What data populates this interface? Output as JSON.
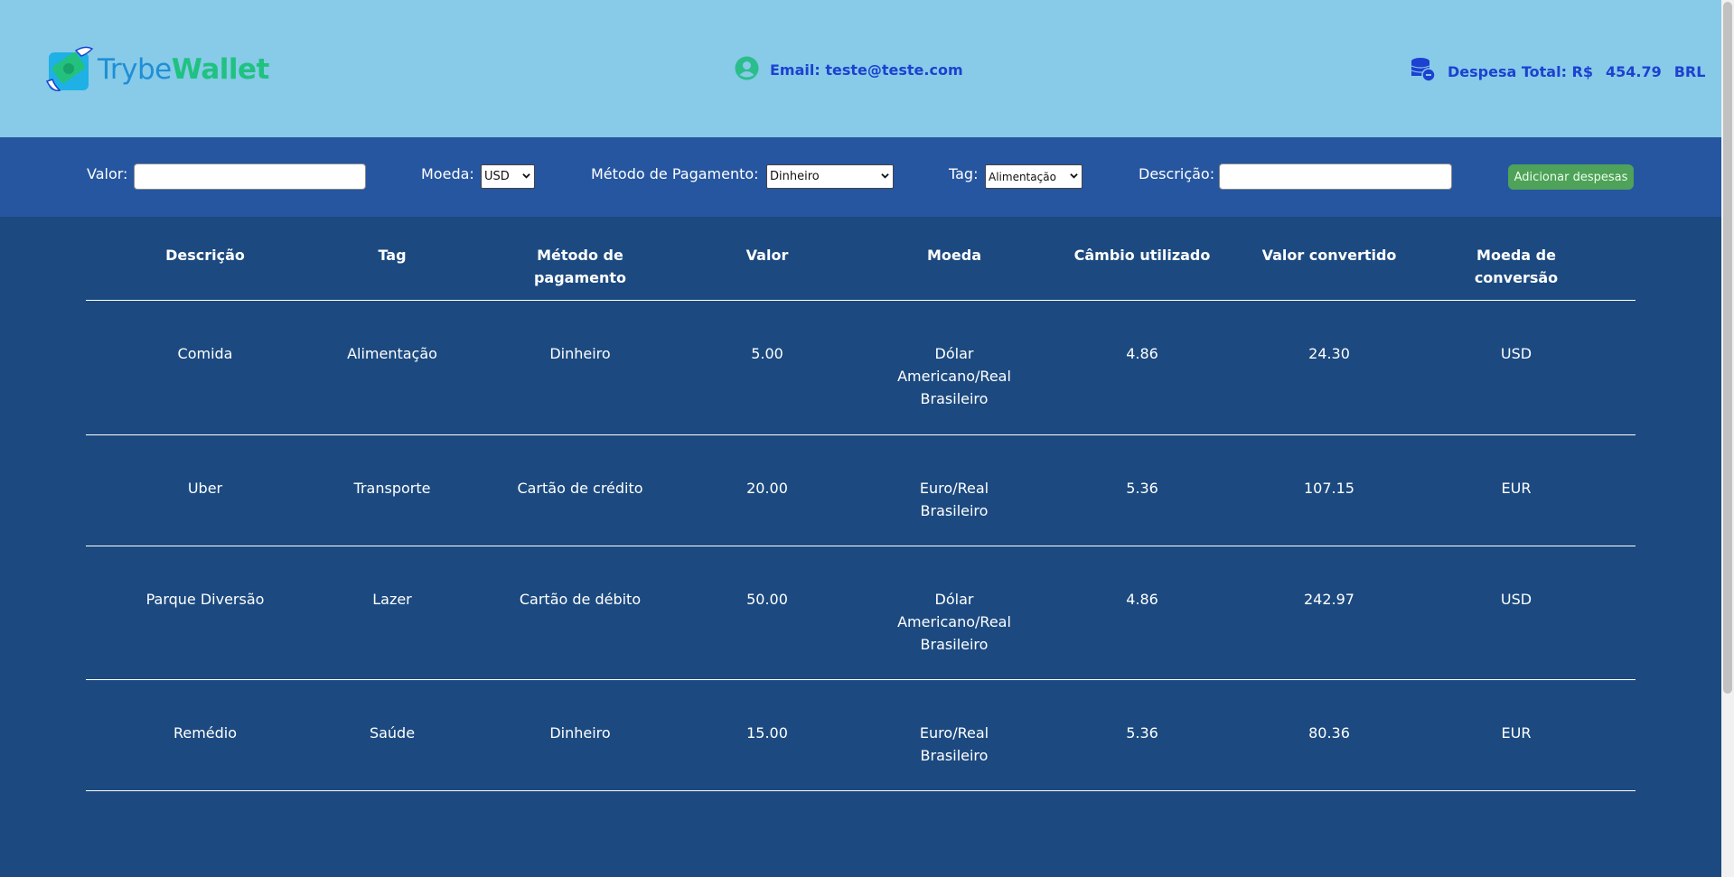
{
  "header": {
    "logo_part1": "Trybe",
    "logo_part2": "Wallet",
    "email_label": "Email: teste@teste.com",
    "total_label": "Despesa Total: R$",
    "total_value": "454.79",
    "total_currency": "BRL"
  },
  "form": {
    "valor_label": "Valor:",
    "valor_value": "",
    "moeda_label": "Moeda:",
    "moeda_selected": "USD",
    "metodo_label": "Método de Pagamento:",
    "metodo_selected": "Dinheiro",
    "tag_label": "Tag:",
    "tag_selected": "Alimentação",
    "descricao_label": "Descrição:",
    "descricao_value": "",
    "add_button": "Adicionar despesas"
  },
  "table": {
    "headers": [
      "Descrição",
      "Tag",
      "Método de pagamento",
      "Valor",
      "Moeda",
      "Câmbio utilizado",
      "Valor convertido",
      "Moeda de conversão"
    ],
    "rows": [
      [
        "Comida",
        "Alimentação",
        "Dinheiro",
        "5.00",
        "Dólar Americano/Real Brasileiro",
        "4.86",
        "24.30",
        "USD"
      ],
      [
        "Uber",
        "Transporte",
        "Cartão de crédito",
        "20.00",
        "Euro/Real Brasileiro",
        "5.36",
        "107.15",
        "EUR"
      ],
      [
        "Parque Diversão",
        "Lazer",
        "Cartão de débito",
        "50.00",
        "Dólar Americano/Real Brasileiro",
        "4.86",
        "242.97",
        "USD"
      ],
      [
        "Remédio",
        "Saúde",
        "Dinheiro",
        "15.00",
        "Euro/Real Brasileiro",
        "5.36",
        "80.36",
        "EUR"
      ]
    ]
  },
  "icons": {
    "logo": "wallet-logo-icon",
    "email": "user-avatar-icon",
    "total": "coins-icon"
  },
  "colors": {
    "header_bg": "#87cbe8",
    "formbar_bg": "#2656a0",
    "table_bg": "#1c4a80",
    "accent_text": "#1d41d0",
    "brand_blue": "#1f8fd6",
    "brand_green": "#1fc281",
    "button_bg": "#4fa259"
  }
}
